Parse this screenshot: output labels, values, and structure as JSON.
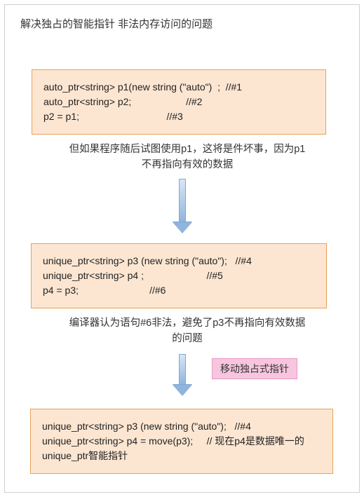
{
  "title": "解决独占的智能指针 非法内存访问的问题",
  "box1_code": "auto_ptr<string> p1(new string (\"auto\")  ;  //#1\nauto_ptr<string> p2;                    //#2\np2 = p1;                                //#3",
  "caption1": "但如果程序随后试图使用p1，这将是件坏事，因为p1不再指向有效的数据",
  "box2_code": "unique_ptr<string> p3 (new string (\"auto\");   //#4\nunique_ptr<string> p4 ;                       //#5\np4 = p3;                          //#6",
  "caption2": "编译器认为语句#6非法，避免了p3不再指向有效数据的问题",
  "tag_label": "移动独占式指针",
  "box3_code": "unique_ptr<string> p3 (new string (\"auto\");   //#4\nunique_ptr<string> p4 = move(p3);     // 现在p4是数据唯一的unique_ptr智能指针"
}
